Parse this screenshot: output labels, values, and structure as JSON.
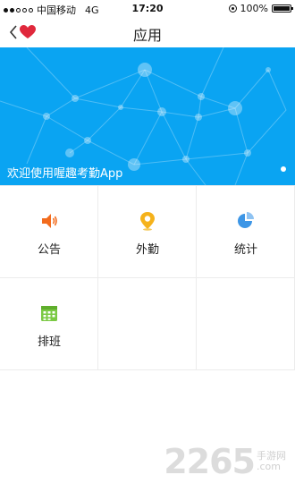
{
  "status_bar": {
    "carrier": "中国移动",
    "network": "4G",
    "time": "17:20",
    "battery": "100%",
    "battery_level": 1.0
  },
  "nav": {
    "title": "应用",
    "back_icon": "chevron-left-icon",
    "heart_icon": "heart-icon",
    "heart_color": "#e0283c"
  },
  "banner": {
    "text": "欢迎使用喔趣考勤App",
    "background": "#0aa4f2"
  },
  "apps": [
    {
      "label": "公告",
      "icon": "speaker-icon",
      "color": "#f26b1d"
    },
    {
      "label": "外勤",
      "icon": "location-pin-icon",
      "color": "#f5b21b"
    },
    {
      "label": "统计",
      "icon": "pie-chart-icon",
      "color": "#3d96e6"
    },
    {
      "label": "排班",
      "icon": "calendar-icon",
      "color": "#7ac943"
    }
  ],
  "watermark": {
    "number": "2265",
    "top": "手游网",
    "bottom": ".com"
  }
}
